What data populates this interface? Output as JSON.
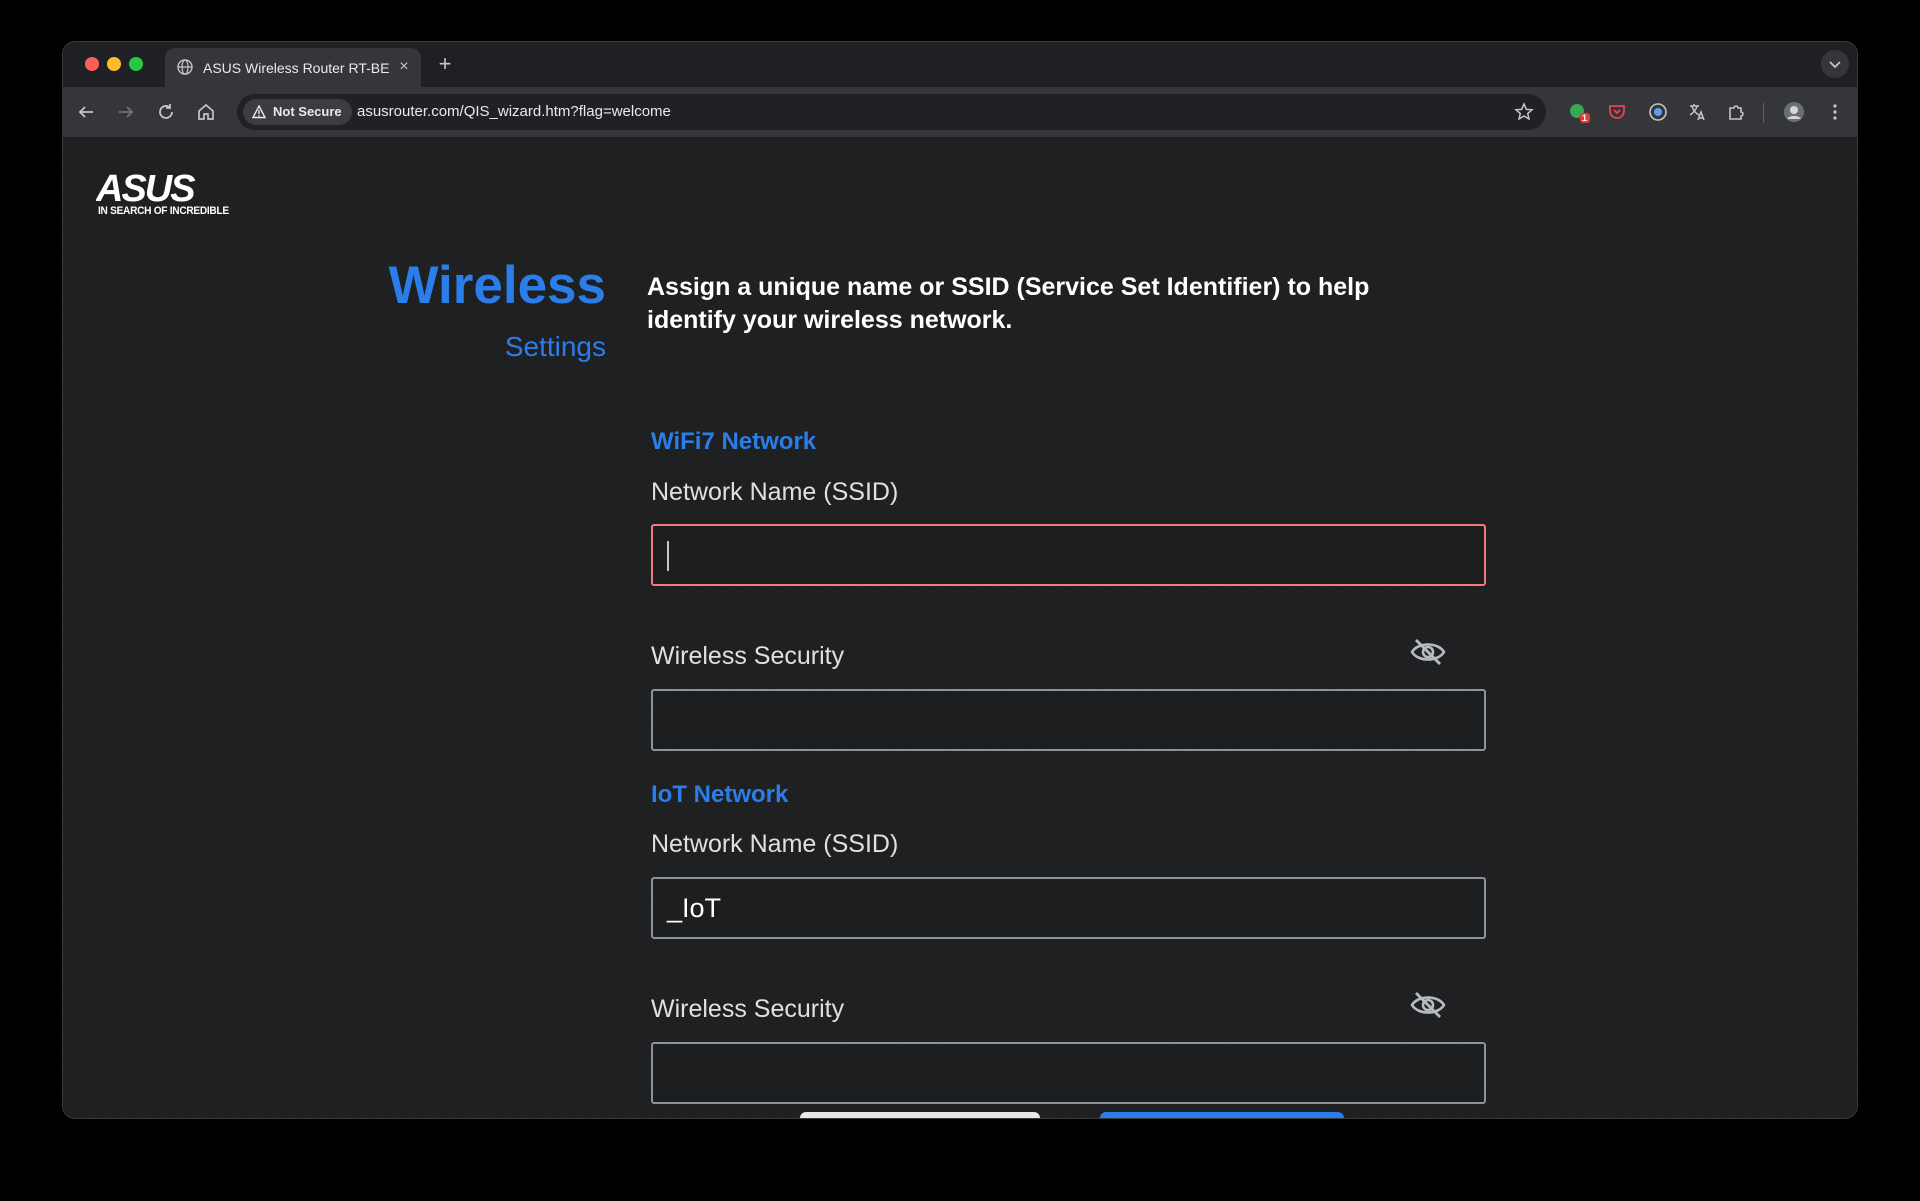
{
  "browser": {
    "tab_title": "ASUS Wireless Router RT-BE",
    "tab_close": "×",
    "new_tab": "+",
    "security_label": "Not Secure",
    "url": "asusrouter.com/QIS_wizard.htm?flag=welcome",
    "extension_badge": "1"
  },
  "brand": {
    "logo": "ASUS",
    "tagline": "IN SEARCH OF INCREDIBLE"
  },
  "page": {
    "heading": "Wireless",
    "subheading": "Settings",
    "description": "Assign a unique name or SSID (Service Set Identifier) to help identify your wireless network."
  },
  "wifi7": {
    "section_title": "WiFi7 Network",
    "ssid_label": "Network Name (SSID)",
    "ssid_value": "",
    "security_label": "Wireless Security",
    "security_value": ""
  },
  "iot": {
    "section_title": "IoT Network",
    "ssid_label": "Network Name (SSID)",
    "ssid_value": "_IoT",
    "security_label": "Wireless Security",
    "security_value": ""
  },
  "colors": {
    "accent": "#2b7de9",
    "focus_border": "#f07b7b",
    "page_bg": "#1d1e20"
  }
}
